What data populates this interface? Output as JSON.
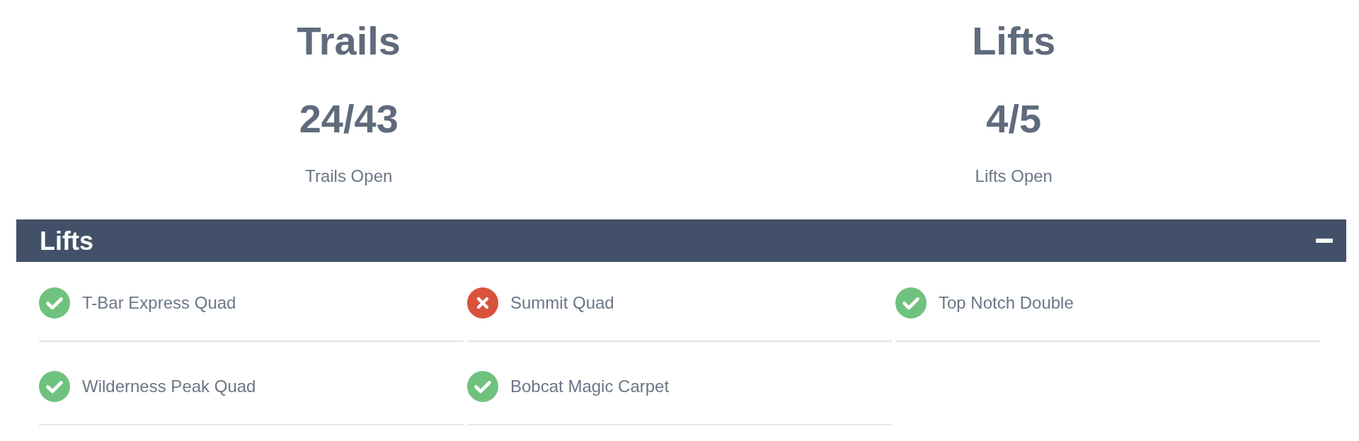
{
  "summary": [
    {
      "title": "Trails",
      "count": "24/43",
      "caption": "Trails Open"
    },
    {
      "title": "Lifts",
      "count": "4/5",
      "caption": "Lifts Open"
    }
  ],
  "section": {
    "title": "Lifts",
    "expanded": true,
    "lifts": [
      {
        "name": "T-Bar Express Quad",
        "open": true
      },
      {
        "name": "Summit Quad",
        "open": false
      },
      {
        "name": "Top Notch Double",
        "open": true
      },
      {
        "name": "Wilderness Peak Quad",
        "open": true
      },
      {
        "name": "Bobcat Magic Carpet",
        "open": true
      }
    ]
  }
}
